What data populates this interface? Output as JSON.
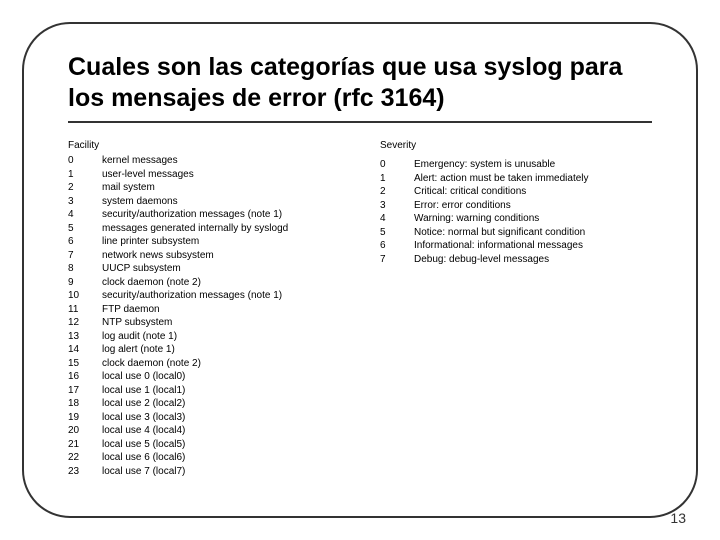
{
  "title": "Cuales son las categorías que usa syslog para los mensajes de error (rfc 3164)",
  "facility_header": "Facility",
  "severity_header": "Severity",
  "facilities": [
    {
      "n": "0",
      "d": "kernel messages"
    },
    {
      "n": "1",
      "d": "user-level messages"
    },
    {
      "n": "2",
      "d": "mail system"
    },
    {
      "n": "3",
      "d": "system daemons"
    },
    {
      "n": "4",
      "d": "security/authorization messages (note 1)"
    },
    {
      "n": "5",
      "d": "messages generated internally by syslogd"
    },
    {
      "n": "6",
      "d": "line printer subsystem"
    },
    {
      "n": "7",
      "d": "network news subsystem"
    },
    {
      "n": "8",
      "d": "UUCP subsystem"
    },
    {
      "n": "9",
      "d": "clock daemon (note 2)"
    },
    {
      "n": "10",
      "d": "security/authorization messages (note 1)"
    },
    {
      "n": "11",
      "d": "FTP daemon"
    },
    {
      "n": "12",
      "d": "NTP subsystem"
    },
    {
      "n": "13",
      "d": "log audit (note 1)"
    },
    {
      "n": "14",
      "d": "log alert (note 1)"
    },
    {
      "n": "15",
      "d": "clock daemon (note 2)"
    },
    {
      "n": "16",
      "d": "local use 0  (local0)"
    },
    {
      "n": "17",
      "d": "local use 1  (local1)"
    },
    {
      "n": "18",
      "d": "local use 2  (local2)"
    },
    {
      "n": "19",
      "d": "local use 3  (local3)"
    },
    {
      "n": "20",
      "d": "local use 4  (local4)"
    },
    {
      "n": "21",
      "d": "local use 5  (local5)"
    },
    {
      "n": "22",
      "d": "local use 6  (local6)"
    },
    {
      "n": "23",
      "d": "local use 7  (local7)"
    }
  ],
  "severities": [
    {
      "n": "0",
      "d": "Emergency: system is unusable"
    },
    {
      "n": "1",
      "d": "Alert: action must be taken immediately"
    },
    {
      "n": "2",
      "d": "Critical: critical conditions"
    },
    {
      "n": "3",
      "d": "Error: error conditions"
    },
    {
      "n": "4",
      "d": "Warning: warning conditions"
    },
    {
      "n": "5",
      "d": "Notice: normal but significant condition"
    },
    {
      "n": "6",
      "d": "Informational: informational messages"
    },
    {
      "n": "7",
      "d": "Debug: debug-level messages"
    }
  ],
  "page_number": "13"
}
